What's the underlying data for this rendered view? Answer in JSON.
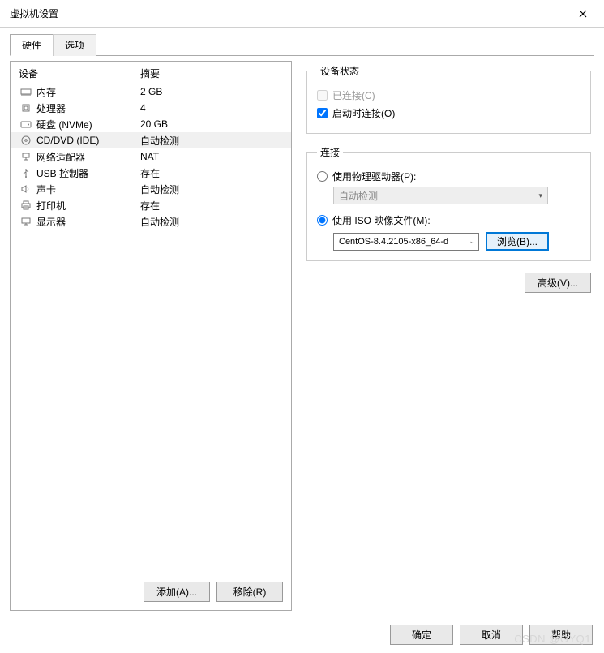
{
  "title": "虚拟机设置",
  "tabs": {
    "hardware": "硬件",
    "options": "选项"
  },
  "columns": {
    "device": "设备",
    "summary": "摘要"
  },
  "devices": [
    {
      "icon": "memory-icon",
      "name": "内存",
      "summary": "2 GB"
    },
    {
      "icon": "cpu-icon",
      "name": "处理器",
      "summary": "4"
    },
    {
      "icon": "disk-icon",
      "name": "硬盘 (NVMe)",
      "summary": "20 GB"
    },
    {
      "icon": "cd-icon",
      "name": "CD/DVD (IDE)",
      "summary": "自动检测"
    },
    {
      "icon": "network-icon",
      "name": "网络适配器",
      "summary": "NAT"
    },
    {
      "icon": "usb-icon",
      "name": "USB 控制器",
      "summary": "存在"
    },
    {
      "icon": "sound-icon",
      "name": "声卡",
      "summary": "自动检测"
    },
    {
      "icon": "printer-icon",
      "name": "打印机",
      "summary": "存在"
    },
    {
      "icon": "display-icon",
      "name": "显示器",
      "summary": "自动检测"
    }
  ],
  "buttons": {
    "add": "添加(A)...",
    "remove": "移除(R)",
    "browse": "浏览(B)...",
    "advanced": "高级(V)...",
    "ok": "确定",
    "cancel": "取消",
    "help": "帮助"
  },
  "status_group": {
    "legend": "设备状态",
    "connected": "已连接(C)",
    "connect_on_start": "启动时连接(O)"
  },
  "connection_group": {
    "legend": "连接",
    "use_physical": "使用物理驱动器(P):",
    "auto_detect": "自动检测",
    "use_iso": "使用 ISO 映像文件(M):",
    "iso_value": "CentOS-8.4.2105-x86_64-d"
  },
  "watermark": "CSDN @GYQ1"
}
